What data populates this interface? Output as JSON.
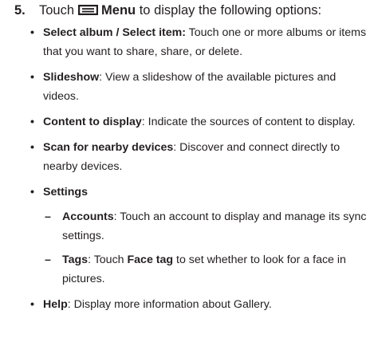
{
  "step": {
    "number": "5.",
    "text_before": "Touch",
    "menu_label": "Menu",
    "text_after": "to display the following options:"
  },
  "items": [
    {
      "label": "Select album / Select item:",
      "text": " Touch one or more albums or items that you want to share, share, or delete."
    },
    {
      "label": "Slideshow",
      "text": ": View a slideshow of the available pictures and videos."
    },
    {
      "label": "Content to display",
      "text": ": Indicate the sources of content to display."
    },
    {
      "label": "Scan for nearby devices",
      "text": ": Discover and connect directly to nearby devices."
    },
    {
      "label": "Settings",
      "text": ""
    },
    {
      "label": "Help",
      "text": ": Display more information about Gallery."
    }
  ],
  "settings_sub": [
    {
      "label": "Accounts",
      "text": ": Touch an account to display and manage its sync settings."
    },
    {
      "label": "Tags",
      "text_before": ": Touch ",
      "inline_label": "Face tag",
      "text_after": " to set whether to look for a face in pictures."
    }
  ],
  "icons": {
    "menu": "menu-icon"
  }
}
